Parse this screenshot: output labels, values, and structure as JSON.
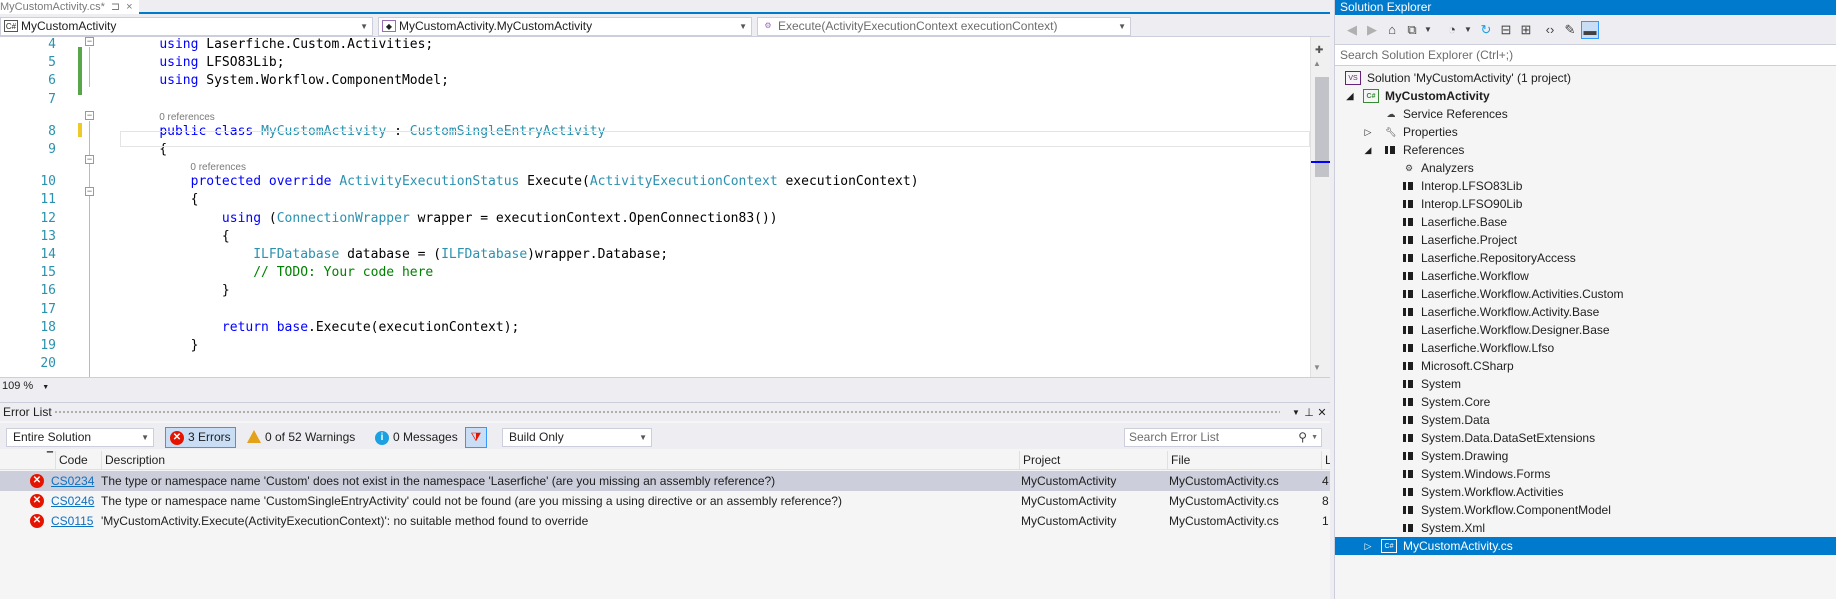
{
  "editor": {
    "tab_title": "MyCustomActivity.cs*",
    "tab_pin": "⊐",
    "tab_close": "×",
    "nav": {
      "project": "MyCustomActivity",
      "class": "MyCustomActivity.MyCustomActivity",
      "member": "Execute(ActivityExecutionContext executionContext)"
    },
    "zoom": "109 %",
    "lines": [
      {
        "num": "4",
        "segs": [
          {
            "t": "    "
          },
          {
            "t": "using",
            "c": "kw"
          },
          {
            "t": " Laserfiche.Custom.Activities;"
          }
        ]
      },
      {
        "num": "5",
        "segs": [
          {
            "t": "    "
          },
          {
            "t": "using",
            "c": "kw"
          },
          {
            "t": " LFSO83Lib;"
          }
        ]
      },
      {
        "num": "6",
        "segs": [
          {
            "t": "    "
          },
          {
            "t": "using",
            "c": "kw"
          },
          {
            "t": " System.Workflow.ComponentModel;"
          }
        ]
      },
      {
        "num": "7",
        "segs": []
      },
      {
        "num": "8",
        "refs": "0 references",
        "segs": [
          {
            "t": "    "
          },
          {
            "t": "public class",
            "c": "kw"
          },
          {
            "t": " "
          },
          {
            "t": "MyCustomActivity",
            "c": "ty"
          },
          {
            "t": " : "
          },
          {
            "t": "CustomSingleEntryActivity",
            "c": "ty"
          }
        ]
      },
      {
        "num": "9",
        "segs": [
          {
            "t": "    {"
          }
        ]
      },
      {
        "num": "10",
        "refs": "0 references",
        "segs": [
          {
            "t": "        "
          },
          {
            "t": "protected override",
            "c": "kw"
          },
          {
            "t": " "
          },
          {
            "t": "ActivityExecutionStatus",
            "c": "ty"
          },
          {
            "t": " Execute("
          },
          {
            "t": "ActivityExecutionContext",
            "c": "ty"
          },
          {
            "t": " executionContext)"
          }
        ]
      },
      {
        "num": "11",
        "segs": [
          {
            "t": "        {"
          }
        ]
      },
      {
        "num": "12",
        "segs": [
          {
            "t": "            "
          },
          {
            "t": "using",
            "c": "kw"
          },
          {
            "t": " ("
          },
          {
            "t": "ConnectionWrapper",
            "c": "ty"
          },
          {
            "t": " wrapper = executionContext.OpenConnection83())"
          }
        ]
      },
      {
        "num": "13",
        "segs": [
          {
            "t": "            {"
          }
        ]
      },
      {
        "num": "14",
        "segs": [
          {
            "t": "                "
          },
          {
            "t": "ILFDatabase",
            "c": "ty"
          },
          {
            "t": " database = ("
          },
          {
            "t": "ILFDatabase",
            "c": "ty"
          },
          {
            "t": ")wrapper.Database;"
          }
        ]
      },
      {
        "num": "15",
        "segs": [
          {
            "t": "                "
          },
          {
            "t": "// TODO: Your code here",
            "c": "cm"
          }
        ]
      },
      {
        "num": "16",
        "segs": [
          {
            "t": "            }"
          }
        ]
      },
      {
        "num": "17",
        "segs": []
      },
      {
        "num": "18",
        "segs": [
          {
            "t": "            "
          },
          {
            "t": "return",
            "c": "kw"
          },
          {
            "t": " "
          },
          {
            "t": "base",
            "c": "kw"
          },
          {
            "t": ".Execute(executionContext);"
          }
        ]
      },
      {
        "num": "19",
        "segs": [
          {
            "t": "        }"
          }
        ]
      },
      {
        "num": "20",
        "segs": []
      }
    ]
  },
  "error_list": {
    "title": "Error List",
    "scope": "Entire Solution",
    "errors_btn": "3 Errors",
    "warnings_btn": "0 of 52 Warnings",
    "messages_btn": "0 Messages",
    "build_filter": "Build Only",
    "search_placeholder": "Search Error List",
    "columns": {
      "code": "Code",
      "description": "Description",
      "project": "Project",
      "file": "File",
      "line": "L"
    },
    "rows": [
      {
        "code": "CS0234",
        "description": "The type or namespace name 'Custom' does not exist in the namespace 'Laserfiche' (are you missing an assembly reference?)",
        "project": "MyCustomActivity",
        "file": "MyCustomActivity.cs",
        "line": "4"
      },
      {
        "code": "CS0246",
        "description": "The type or namespace name 'CustomSingleEntryActivity' could not be found (are you missing a using directive or an assembly reference?)",
        "project": "MyCustomActivity",
        "file": "MyCustomActivity.cs",
        "line": "8"
      },
      {
        "code": "CS0115",
        "description": "'MyCustomActivity.Execute(ActivityExecutionContext)': no suitable method found to override",
        "project": "MyCustomActivity",
        "file": "MyCustomActivity.cs",
        "line": "1"
      }
    ]
  },
  "solution_explorer": {
    "title": "Solution Explorer",
    "search_placeholder": "Search Solution Explorer (Ctrl+;)",
    "solution": "Solution 'MyCustomActivity' (1 project)",
    "project": "MyCustomActivity",
    "service_refs": "Service References",
    "properties": "Properties",
    "references": "References",
    "analyzers": "Analyzers",
    "reference_items": [
      "Interop.LFSO83Lib",
      "Interop.LFSO90Lib",
      "Laserfiche.Base",
      "Laserfiche.Project",
      "Laserfiche.RepositoryAccess",
      "Laserfiche.Workflow",
      "Laserfiche.Workflow.Activities.Custom",
      "Laserfiche.Workflow.Activity.Base",
      "Laserfiche.Workflow.Designer.Base",
      "Laserfiche.Workflow.Lfso",
      "Microsoft.CSharp",
      "System",
      "System.Core",
      "System.Data",
      "System.Data.DataSetExtensions",
      "System.Drawing",
      "System.Windows.Forms",
      "System.Workflow.Activities",
      "System.Workflow.ComponentModel",
      "System.Xml"
    ],
    "file": "MyCustomActivity.cs"
  },
  "colors": {
    "accent": "#007acc",
    "error": "#e51400",
    "warning": "#e3a21a",
    "info": "#1ba1e2"
  }
}
